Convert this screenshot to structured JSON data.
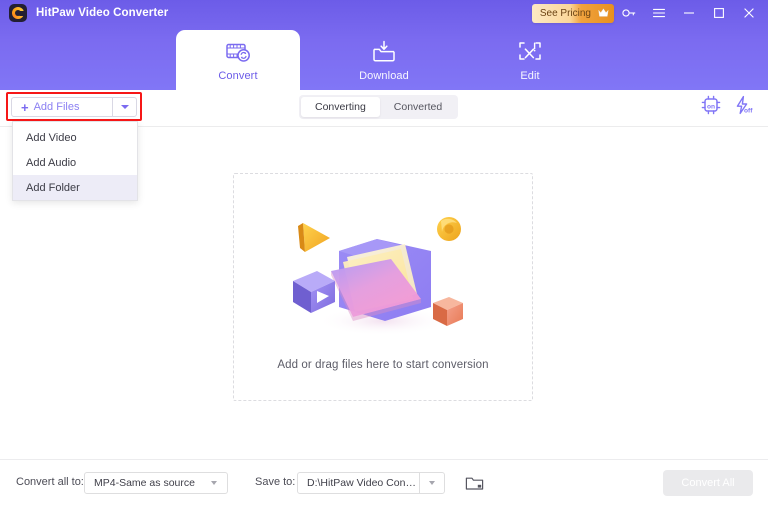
{
  "window": {
    "app_title": "HitPaw Video Converter",
    "logo_icon": "hitpaw-logo-icon",
    "pricing_button": {
      "label": "See Pricing",
      "icon": "crown-icon",
      "gradient_start": "#fde9c4",
      "gradient_end": "#e8901f"
    },
    "controls": [
      {
        "name": "key-icon",
        "glyph": "key"
      },
      {
        "name": "menu-icon",
        "glyph": "hamburger"
      },
      {
        "name": "minimize-icon",
        "glyph": "minimize"
      },
      {
        "name": "maximize-icon",
        "glyph": "maximize"
      },
      {
        "name": "close-icon",
        "glyph": "close"
      }
    ],
    "header_color": "#7b6bf0"
  },
  "tabs": [
    {
      "label": "Convert",
      "icon": "film-convert-icon",
      "active": true
    },
    {
      "label": "Download",
      "icon": "folder-download-icon",
      "active": false
    },
    {
      "label": "Edit",
      "icon": "edit-screen-icon",
      "active": false
    }
  ],
  "toolbar": {
    "add_files": {
      "label": "Add Files",
      "plus_icon": "plus-icon",
      "caret_icon": "chevron-down-icon",
      "highlight_color": "#f61717",
      "accent_color": "#7b6bf0"
    },
    "dropdown": {
      "open": true,
      "items": [
        {
          "label": "Add Video",
          "hovered": false
        },
        {
          "label": "Add Audio",
          "hovered": false
        },
        {
          "label": "Add Folder",
          "hovered": true
        }
      ]
    },
    "segments": [
      {
        "label": "Converting",
        "active": true
      },
      {
        "label": "Converted",
        "active": false
      }
    ],
    "tools": [
      {
        "name": "hardware-acceleration-icon",
        "state": "on"
      },
      {
        "name": "lightning-speed-icon",
        "state": "off"
      }
    ]
  },
  "main": {
    "dropzone": {
      "text": "Add or drag files here to start conversion",
      "illustration": "folder-3d-illustration"
    }
  },
  "bottom": {
    "convert_all_to_label": "Convert all to:",
    "format_value": "MP4-Same as source",
    "save_to_label": "Save to:",
    "save_path_value": "D:\\HitPaw Video Conve...",
    "folder_icon": "open-folder-icon",
    "convert_all_button": "Convert All"
  }
}
